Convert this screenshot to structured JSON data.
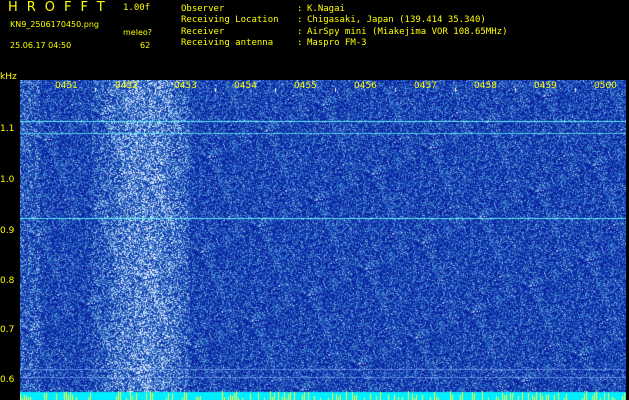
{
  "header": {
    "app_title": "HROFFT",
    "version": "1.00f",
    "filename": "KN9_2506170450.png",
    "datetime": "25.06.17 04:50",
    "meleo_label": "meleo?",
    "meleo_value": "62"
  },
  "metadata": [
    {
      "label": "Observer",
      "sep": ":",
      "value": "K.Nagai"
    },
    {
      "label": "Receiving Location",
      "sep": ":",
      "value": "Chigasaki, Japan (139.414 35.340)"
    },
    {
      "label": "Receiver",
      "sep": ":",
      "value": "AirSpy mini (Miakejima VOR 108.65MHz)"
    },
    {
      "label": "Receiving antenna",
      "sep": ":",
      "value": "Maspro FM-3"
    }
  ],
  "spectrogram": {
    "y_unit": "kHz",
    "y_ticks": [
      "1.1",
      "1.0",
      "0.9",
      "0.8",
      "0.7",
      "0.6"
    ],
    "x_ticks": [
      "0451",
      "0452",
      "0453",
      "0454",
      "0455",
      "0456",
      "0457",
      "0458",
      "0459",
      "0500"
    ],
    "colors": {
      "background": "#0a1a9e",
      "noise_high": "#33ccff",
      "line": "#66ffff",
      "bottom_bar": "#00eeff",
      "label": "#ffff00"
    }
  }
}
